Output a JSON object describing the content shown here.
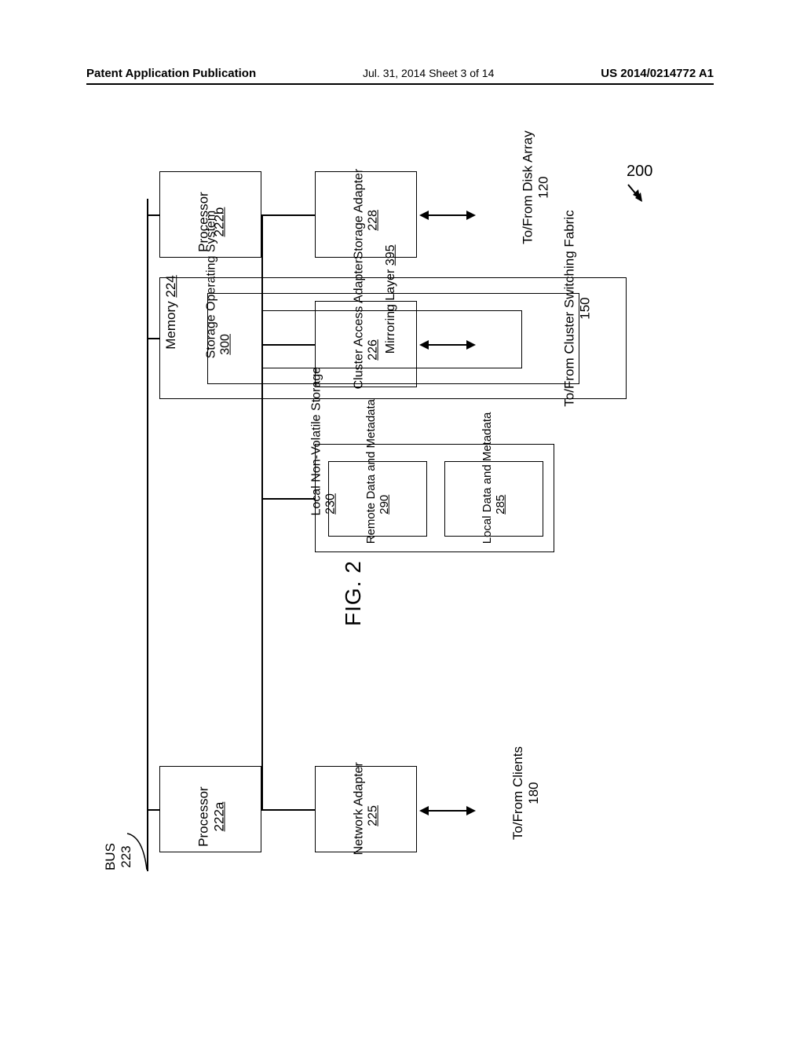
{
  "header": {
    "left": "Patent Application Publication",
    "center": "Jul. 31, 2014  Sheet 3 of 14",
    "right": "US 2014/0214772 A1"
  },
  "ref200": "200",
  "bus": {
    "label": "BUS",
    "num": "223"
  },
  "memory": {
    "label": "Memory",
    "num": "224"
  },
  "sos": {
    "label": "Storage Operating System",
    "num": "300"
  },
  "mirror": {
    "label": "Mirroring Layer",
    "num": "395"
  },
  "proc_b": {
    "label": "Processor",
    "num": "222b"
  },
  "proc_a": {
    "label": "Processor",
    "num": "222a"
  },
  "storage_adapter": {
    "label": "Storage Adapter",
    "num": "228"
  },
  "cluster_adapter": {
    "label": "Cluster Access Adapter",
    "num": "226"
  },
  "network_adapter": {
    "label": "Network Adapter",
    "num": "225"
  },
  "nvs": {
    "label": "Local Non-Volatile Storage",
    "num": "230"
  },
  "remote": {
    "label": "Remote Data and Metadata",
    "num": "290"
  },
  "local": {
    "label": "Local Data and Metadata",
    "num": "285"
  },
  "tofrom": {
    "disk": {
      "label": "To/From Disk Array",
      "num": "120"
    },
    "cluster": {
      "label": "To/From Cluster Switching Fabric",
      "num": "150"
    },
    "clients": {
      "label": "To/From Clients",
      "num": "180"
    }
  },
  "figure": "FIG. 2"
}
